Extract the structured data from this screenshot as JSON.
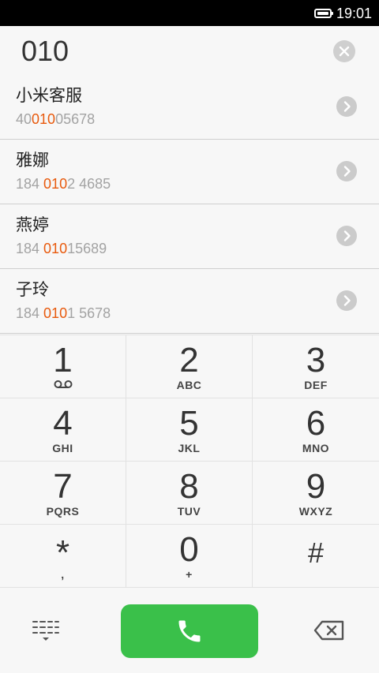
{
  "status_bar": {
    "time": "19:01",
    "battery_icon": "battery-full-icon"
  },
  "input": {
    "number": "010",
    "clear_icon": "clear-icon"
  },
  "results": [
    {
      "name": "小米客服",
      "number_prefix": "40",
      "number_match": "010",
      "number_suffix": "05678"
    },
    {
      "name": "雅娜",
      "number_prefix": "184 ",
      "number_match": "010",
      "number_suffix": "2 4685"
    },
    {
      "name": "燕婷",
      "number_prefix": "184 ",
      "number_match": "010",
      "number_suffix": "15689"
    },
    {
      "name": "子玲",
      "number_prefix": "184 ",
      "number_match": "010",
      "number_suffix": "1 5678"
    }
  ],
  "keypad": [
    {
      "digit": "1",
      "letters": "",
      "icon": "voicemail-icon"
    },
    {
      "digit": "2",
      "letters": "ABC"
    },
    {
      "digit": "3",
      "letters": "DEF"
    },
    {
      "digit": "4",
      "letters": "GHI"
    },
    {
      "digit": "5",
      "letters": "JKL"
    },
    {
      "digit": "6",
      "letters": "MNO"
    },
    {
      "digit": "7",
      "letters": "PQRS"
    },
    {
      "digit": "8",
      "letters": "TUV"
    },
    {
      "digit": "9",
      "letters": "WXYZ"
    },
    {
      "digit": "*",
      "letters": ","
    },
    {
      "digit": "0",
      "letters": "+"
    },
    {
      "digit": "#",
      "letters": ""
    }
  ],
  "colors": {
    "highlight": "#e8590c",
    "call_green": "#3ac04a"
  },
  "bottom_bar": {
    "left_icon": "dialpad-toggle-icon",
    "call_icon": "phone-icon",
    "right_icon": "backspace-icon"
  }
}
